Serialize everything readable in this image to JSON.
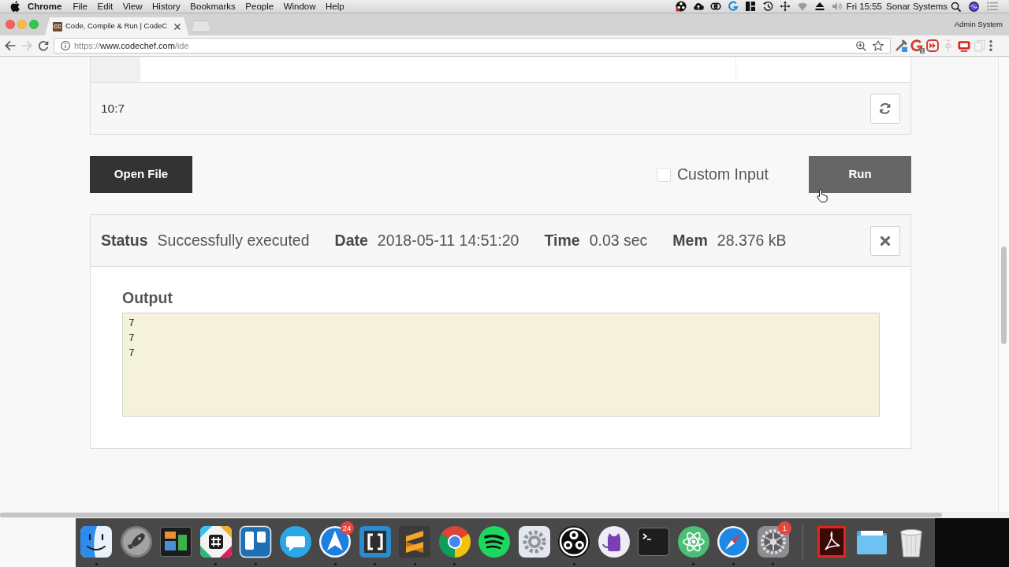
{
  "menu_bar": {
    "app_name": "Chrome",
    "menus": [
      "File",
      "Edit",
      "View",
      "History",
      "Bookmarks",
      "People",
      "Window",
      "Help"
    ],
    "status_icons": [
      {
        "kind": "disc",
        "dimmed": false
      },
      {
        "kind": "cloud",
        "dimmed": false
      },
      {
        "kind": "rings",
        "dimmed": false
      },
      {
        "kind": "arc",
        "dimmed": false
      },
      {
        "kind": "blocks",
        "dimmed": false
      },
      {
        "kind": "history",
        "dimmed": false
      },
      {
        "kind": "arrows",
        "dimmed": false
      },
      {
        "kind": "wifi",
        "dimmed": true
      },
      {
        "kind": "eject",
        "dimmed": false
      },
      {
        "kind": "volume",
        "dimmed": true
      }
    ],
    "clock": "Fri 15:55",
    "user": "Sonar Systems"
  },
  "browser": {
    "tabs": [
      {
        "favicon": "CC",
        "title": "Code, Compile & Run | CodeC",
        "selected": true
      }
    ],
    "profile": "Admin System",
    "nav_buttons": [
      {
        "kind": "back",
        "disabled": false
      },
      {
        "kind": "forward",
        "disabled": true
      },
      {
        "kind": "reload",
        "disabled": false
      }
    ],
    "address": {
      "scheme": "https://",
      "host": "www.codechef.com",
      "path": "/ide"
    },
    "bookmarked": false,
    "extensions": [
      {
        "kind": "dropper",
        "dimmed": false
      },
      {
        "kind": "arc",
        "badge": "1",
        "dimmed": false
      },
      {
        "kind": "skip",
        "dimmed": false
      },
      {
        "kind": "pin",
        "dimmed": true
      },
      {
        "kind": "monitor",
        "dimmed": false
      },
      {
        "kind": "copy",
        "dimmed": true
      }
    ]
  },
  "editor": {
    "cursor_position": "10:7"
  },
  "actions": {
    "open_file": "Open File",
    "custom_input": {
      "label": "Custom Input",
      "checked": false
    },
    "run": "Run"
  },
  "result": {
    "fields": [
      {
        "label": "Status",
        "value": "Successfully executed"
      },
      {
        "label": "Date",
        "value": "2018-05-11 14:51:20"
      },
      {
        "label": "Time",
        "value": "0.03 sec"
      },
      {
        "label": "Mem",
        "value": "28.376 kB"
      }
    ],
    "output_title": "Output",
    "output": "7\n7\n7"
  },
  "dock": {
    "apps": [
      {
        "kind": "face",
        "running": true
      },
      {
        "kind": "rocket",
        "running": false
      },
      {
        "kind": "panels",
        "running": false
      },
      {
        "kind": "tile",
        "running": true
      },
      {
        "kind": "columns",
        "running": true
      },
      {
        "kind": "bubble",
        "running": false
      },
      {
        "kind": "plane",
        "badge": "24",
        "running": true
      },
      {
        "kind": "brackets",
        "running": true
      },
      {
        "kind": "stripes",
        "running": true
      },
      {
        "kind": "ring",
        "running": true
      },
      {
        "kind": "waves",
        "running": false
      },
      {
        "kind": "cog",
        "running": false
      },
      {
        "kind": "blades",
        "running": true
      },
      {
        "kind": "cat",
        "running": false
      },
      {
        "kind": "terminal",
        "running": false
      },
      {
        "kind": "atom",
        "running": true
      },
      {
        "kind": "compass",
        "running": true
      },
      {
        "kind": "settings",
        "badge": "1",
        "running": true
      }
    ],
    "stacks": [
      {
        "kind": "document"
      },
      {
        "kind": "folder"
      },
      {
        "kind": "trash"
      }
    ]
  }
}
